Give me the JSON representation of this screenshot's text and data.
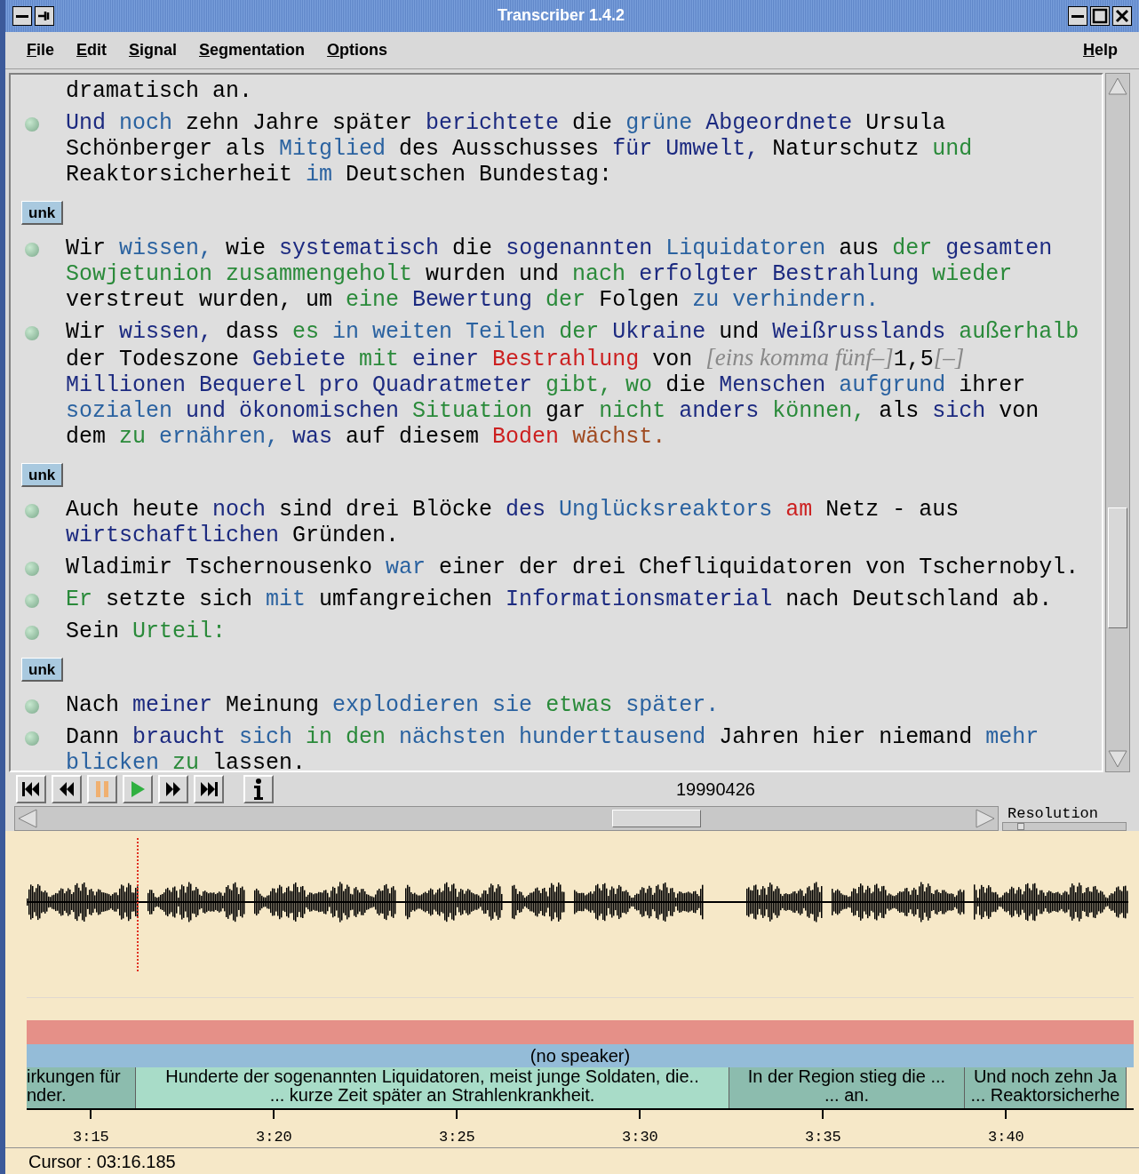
{
  "window": {
    "title": "Transcriber 1.4.2"
  },
  "menu": [
    {
      "label": "File"
    },
    {
      "label": "Edit"
    },
    {
      "label": "Signal"
    },
    {
      "label": "Segmentation"
    },
    {
      "label": "Options"
    }
  ],
  "help_menu": {
    "label": "Help"
  },
  "transcript": [
    {
      "kind": "continuation",
      "runs": [
        {
          "kind": "word",
          "text": "dramatisch an.",
          "color": "#000000"
        }
      ]
    },
    {
      "kind": "sentence",
      "runs": [
        {
          "kind": "word",
          "text": "Und",
          "color": "#1c2a80"
        },
        {
          "kind": "word",
          "text": " noch",
          "color": "#2a62a0"
        },
        {
          "kind": "word",
          "text": " zehn Jahre später",
          "color": "#000000"
        },
        {
          "kind": "word",
          "text": " berichtete",
          "color": "#1c2a80"
        },
        {
          "kind": "word",
          "text": " die",
          "color": "#000000"
        },
        {
          "kind": "word",
          "text": " grüne",
          "color": "#2a62a0"
        },
        {
          "kind": "word",
          "text": " Abgeordnete",
          "color": "#1c2a80"
        },
        {
          "kind": "word",
          "text": " Ursula Schönberger als",
          "color": "#000000"
        },
        {
          "kind": "word",
          "text": " Mitglied",
          "color": "#2a62a0"
        },
        {
          "kind": "word",
          "text": " des Ausschusses",
          "color": "#000000"
        },
        {
          "kind": "word",
          "text": " für Umwelt,",
          "color": "#1c2a80"
        },
        {
          "kind": "word",
          "text": " Naturschutz",
          "color": "#000000"
        },
        {
          "kind": "word",
          "text": " und",
          "color": "#2a8a3a"
        },
        {
          "kind": "word",
          "text": " Reaktorsicherheit",
          "color": "#000000"
        },
        {
          "kind": "word",
          "text": " im",
          "color": "#2a62a0"
        },
        {
          "kind": "word",
          "text": " Deutschen Bundestag:",
          "color": "#000000"
        }
      ]
    },
    {
      "kind": "turn",
      "label": "unk"
    },
    {
      "kind": "sentence",
      "runs": [
        {
          "kind": "word",
          "text": "Wir",
          "color": "#000000"
        },
        {
          "kind": "word",
          "text": " wissen,",
          "color": "#2a62a0"
        },
        {
          "kind": "word",
          "text": " wie",
          "color": "#000000"
        },
        {
          "kind": "word",
          "text": " systematisch",
          "color": "#1c2a80"
        },
        {
          "kind": "word",
          "text": " die",
          "color": "#000000"
        },
        {
          "kind": "word",
          "text": " sogenannten",
          "color": "#1c2a80"
        },
        {
          "kind": "word",
          "text": " Liquidatoren",
          "color": "#2a62a0"
        },
        {
          "kind": "word",
          "text": " aus",
          "color": "#000000"
        },
        {
          "kind": "word",
          "text": " der",
          "color": "#2a8a3a"
        },
        {
          "kind": "word",
          "text": " gesamten",
          "color": "#1c2a80"
        },
        {
          "kind": "word",
          "text": " Sowjetunion zusammengeholt",
          "color": "#2a8a3a"
        },
        {
          "kind": "word",
          "text": " wurden und",
          "color": "#000000"
        },
        {
          "kind": "word",
          "text": " nach",
          "color": "#2a8a3a"
        },
        {
          "kind": "word",
          "text": " erfolgter Bestrahlung",
          "color": "#1c2a80"
        },
        {
          "kind": "word",
          "text": " wieder",
          "color": "#2a8a3a"
        },
        {
          "kind": "word",
          "text": " verstreut wurden, um",
          "color": "#000000"
        },
        {
          "kind": "word",
          "text": " eine",
          "color": "#2a8a3a"
        },
        {
          "kind": "word",
          "text": " Bewertung",
          "color": "#1c2a80"
        },
        {
          "kind": "word",
          "text": " der",
          "color": "#2a8a3a"
        },
        {
          "kind": "word",
          "text": " Folgen",
          "color": "#000000"
        },
        {
          "kind": "word",
          "text": " zu verhindern.",
          "color": "#2a62a0"
        }
      ]
    },
    {
      "kind": "sentence",
      "runs": [
        {
          "kind": "word",
          "text": "Wir",
          "color": "#000000"
        },
        {
          "kind": "word",
          "text": " wissen,",
          "color": "#1c2a80"
        },
        {
          "kind": "word",
          "text": " dass",
          "color": "#000000"
        },
        {
          "kind": "word",
          "text": " es",
          "color": "#2a8a3a"
        },
        {
          "kind": "word",
          "text": " in weiten Teilen",
          "color": "#2a62a0"
        },
        {
          "kind": "word",
          "text": " der",
          "color": "#2a8a3a"
        },
        {
          "kind": "word",
          "text": " Ukraine",
          "color": "#1c2a80"
        },
        {
          "kind": "word",
          "text": " und",
          "color": "#000000"
        },
        {
          "kind": "word",
          "text": " Weißrusslands",
          "color": "#1c2a80"
        },
        {
          "kind": "word",
          "text": " außerhalb",
          "color": "#2a8a3a"
        },
        {
          "kind": "word",
          "text": " der Todeszone",
          "color": "#000000"
        },
        {
          "kind": "word",
          "text": " Gebiete",
          "color": "#1c2a80"
        },
        {
          "kind": "word",
          "text": " mit",
          "color": "#2a8a3a"
        },
        {
          "kind": "word",
          "text": " einer",
          "color": "#1c2a80"
        },
        {
          "kind": "word",
          "text": " Bestrahlung",
          "color": "#cc2020"
        },
        {
          "kind": "word",
          "text": " von ",
          "color": "#000000"
        },
        {
          "kind": "event",
          "text": "[eins komma fünf–]",
          "color": "#888888"
        },
        {
          "kind": "word",
          "text": "1,5",
          "color": "#000000"
        },
        {
          "kind": "event",
          "text": "[–]",
          "color": "#888888"
        },
        {
          "kind": "word",
          "text": " Millionen Bequerel pro Quadratmeter",
          "color": "#1c2a80"
        },
        {
          "kind": "word",
          "text": " gibt, wo",
          "color": "#2a8a3a"
        },
        {
          "kind": "word",
          "text": " die",
          "color": "#000000"
        },
        {
          "kind": "word",
          "text": " Menschen",
          "color": "#1c2a80"
        },
        {
          "kind": "word",
          "text": " aufgrund",
          "color": "#2a62a0"
        },
        {
          "kind": "word",
          "text": " ihrer",
          "color": "#000000"
        },
        {
          "kind": "word",
          "text": " sozialen",
          "color": "#2a62a0"
        },
        {
          "kind": "word",
          "text": " und ökonomischen",
          "color": "#1c2a80"
        },
        {
          "kind": "word",
          "text": " Situation",
          "color": "#2a8a3a"
        },
        {
          "kind": "word",
          "text": " gar",
          "color": "#000000"
        },
        {
          "kind": "word",
          "text": " nicht",
          "color": "#2a8a3a"
        },
        {
          "kind": "word",
          "text": " anders",
          "color": "#1c2a80"
        },
        {
          "kind": "word",
          "text": " können,",
          "color": "#2a8a3a"
        },
        {
          "kind": "word",
          "text": " als",
          "color": "#000000"
        },
        {
          "kind": "word",
          "text": " sich",
          "color": "#1c2a80"
        },
        {
          "kind": "word",
          "text": " von dem",
          "color": "#000000"
        },
        {
          "kind": "word",
          "text": " zu",
          "color": "#2a8a3a"
        },
        {
          "kind": "word",
          "text": " ernähren,",
          "color": "#2a62a0"
        },
        {
          "kind": "word",
          "text": " was",
          "color": "#1c2a80"
        },
        {
          "kind": "word",
          "text": " auf diesem",
          "color": "#000000"
        },
        {
          "kind": "word",
          "text": " Boden",
          "color": "#cc2020"
        },
        {
          "kind": "word",
          "text": " wächst.",
          "color": "#a04a20"
        }
      ]
    },
    {
      "kind": "turn",
      "label": "unk"
    },
    {
      "kind": "sentence",
      "runs": [
        {
          "kind": "word",
          "text": "Auch heute",
          "color": "#000000"
        },
        {
          "kind": "word",
          "text": " noch",
          "color": "#1c2a80"
        },
        {
          "kind": "word",
          "text": " sind drei Blöcke",
          "color": "#000000"
        },
        {
          "kind": "word",
          "text": " des",
          "color": "#1c2a80"
        },
        {
          "kind": "word",
          "text": " Unglücksreaktors",
          "color": "#2a62a0"
        },
        {
          "kind": "word",
          "text": " am",
          "color": "#cc2020"
        },
        {
          "kind": "word",
          "text": " Netz - aus",
          "color": "#000000"
        },
        {
          "kind": "word",
          "text": " wirtschaftlichen",
          "color": "#1c2a80"
        },
        {
          "kind": "word",
          "text": " Gründen.",
          "color": "#000000"
        }
      ]
    },
    {
      "kind": "sentence",
      "runs": [
        {
          "kind": "word",
          "text": "Wladimir Tschernousenko",
          "color": "#000000"
        },
        {
          "kind": "word",
          "text": " war",
          "color": "#2a62a0"
        },
        {
          "kind": "word",
          "text": " einer der drei Chefliquidatoren von Tschernobyl.",
          "color": "#000000"
        }
      ]
    },
    {
      "kind": "sentence",
      "runs": [
        {
          "kind": "word",
          "text": "Er",
          "color": "#2a8a3a"
        },
        {
          "kind": "word",
          "text": " setzte sich",
          "color": "#000000"
        },
        {
          "kind": "word",
          "text": " mit",
          "color": "#2a62a0"
        },
        {
          "kind": "word",
          "text": " umfangreichen",
          "color": "#000000"
        },
        {
          "kind": "word",
          "text": " Informationsmaterial",
          "color": "#1c2a80"
        },
        {
          "kind": "word",
          "text": " nach Deutschland ab.",
          "color": "#000000"
        }
      ]
    },
    {
      "kind": "sentence",
      "runs": [
        {
          "kind": "word",
          "text": "Sein",
          "color": "#000000"
        },
        {
          "kind": "word",
          "text": " Urteil:",
          "color": "#2a8a3a"
        }
      ]
    },
    {
      "kind": "turn",
      "label": "unk"
    },
    {
      "kind": "sentence",
      "runs": [
        {
          "kind": "word",
          "text": "Nach",
          "color": "#000000"
        },
        {
          "kind": "word",
          "text": " meiner",
          "color": "#1c2a80"
        },
        {
          "kind": "word",
          "text": " Meinung",
          "color": "#000000"
        },
        {
          "kind": "word",
          "text": " explodieren sie",
          "color": "#2a62a0"
        },
        {
          "kind": "word",
          "text": " etwas",
          "color": "#2a8a3a"
        },
        {
          "kind": "word",
          "text": " später.",
          "color": "#2a62a0"
        }
      ]
    },
    {
      "kind": "sentence",
      "runs": [
        {
          "kind": "word",
          "text": "Dann",
          "color": "#000000"
        },
        {
          "kind": "word",
          "text": " braucht",
          "color": "#1c2a80"
        },
        {
          "kind": "word",
          "text": " sich",
          "color": "#2a62a0"
        },
        {
          "kind": "word",
          "text": " in den",
          "color": "#2a8a3a"
        },
        {
          "kind": "word",
          "text": " nächsten hunderttausend",
          "color": "#2a62a0"
        },
        {
          "kind": "word",
          "text": " Jahren hier niemand",
          "color": "#000000"
        },
        {
          "kind": "word",
          "text": " mehr blicken",
          "color": "#2a62a0"
        },
        {
          "kind": "word",
          "text": " zu",
          "color": "#2a8a3a"
        },
        {
          "kind": "word",
          "text": " lassen.",
          "color": "#000000"
        }
      ]
    }
  ],
  "player": {
    "buttons": [
      {
        "kind": "first"
      },
      {
        "kind": "rewind"
      },
      {
        "kind": "pause"
      },
      {
        "kind": "play"
      },
      {
        "kind": "forward"
      },
      {
        "kind": "last"
      },
      {
        "kind": "info"
      }
    ],
    "file_name": "19990426",
    "resolution": {
      "label": "Resolution",
      "level": 0.12
    }
  },
  "timeline": {
    "speaker": "(no speaker)",
    "segments": [
      {
        "lines": [
          "irkungen für",
          "nder."
        ],
        "selected": false
      },
      {
        "lines": [
          "Hunderte der sogenannten Liquidatoren, meist junge Soldaten, die..",
          "... kurze Zeit später an Strahlenkrankheit."
        ],
        "selected": true
      },
      {
        "lines": [
          "In der Region stieg die ...",
          "... an."
        ],
        "selected": false
      },
      {
        "lines": [
          "Und noch zehn Ja",
          "... Reaktorsicherhe"
        ],
        "selected": false
      }
    ],
    "ticks": [
      "3:15",
      "3:20",
      "3:25",
      "3:30",
      "3:35",
      "3:40"
    ]
  },
  "status_bar": "Cursor : 03:16.185"
}
